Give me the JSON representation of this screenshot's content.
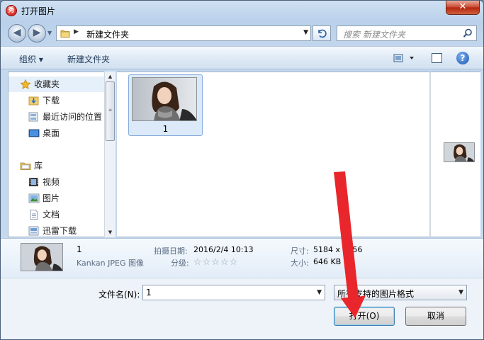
{
  "window": {
    "title": "打开图片",
    "app_icon_glyph": "秀",
    "close_label": "✕"
  },
  "address_bar": {
    "current_folder": "新建文件夹",
    "refresh_icon": "refresh-icon",
    "search_placeholder": "搜索 新建文件夹"
  },
  "toolbar": {
    "organize_label": "组织 ▾",
    "new_folder_label": "新建文件夹",
    "help_label": "?"
  },
  "nav_pane": {
    "items": [
      {
        "label": "收藏夹",
        "icon": "star-icon"
      },
      {
        "label": "下载",
        "icon": "download-folder-icon"
      },
      {
        "label": "最近访问的位置",
        "icon": "recent-places-icon"
      },
      {
        "label": "桌面",
        "icon": "desktop-icon"
      },
      {
        "label": "库",
        "icon": "library-icon"
      },
      {
        "label": "视频",
        "icon": "video-library-icon"
      },
      {
        "label": "图片",
        "icon": "pictures-library-icon"
      },
      {
        "label": "文档",
        "icon": "documents-library-icon"
      },
      {
        "label": "迅雷下载",
        "icon": "thunder-download-icon"
      }
    ]
  },
  "files": [
    {
      "name": "1",
      "selected": true
    }
  ],
  "details": {
    "name": "1",
    "type": "Kankan JPEG 图像",
    "date_label": "拍摄日期:",
    "date_value": "2016/2/4 10:13",
    "rating_label": "分级:",
    "rating_stars": "☆☆☆☆☆",
    "dimensions_label": "尺寸:",
    "dimensions_value": "5184 x 3456",
    "size_label": "大小:",
    "size_value": "646 KB"
  },
  "bottom": {
    "filename_label": "文件名(N):",
    "filename_value": "1",
    "filetype_value": "所有支持的图片格式",
    "open_button": "打开(O)",
    "cancel_button": "取消"
  },
  "colors": {
    "annotation_arrow": "#e8262b",
    "selection": "#dce9f8"
  }
}
